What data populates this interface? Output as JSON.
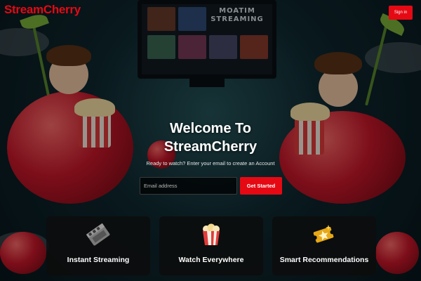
{
  "header": {
    "logo_text": "StreamCherry",
    "signin_label": "Sign in"
  },
  "hero": {
    "title_line1": "Welcome To",
    "title_line2": "StreamCherry",
    "subtitle": "Ready to watch? Enter your email to create an Account",
    "email_placeholder": "Email address",
    "cta_label": "Get Started"
  },
  "features": [
    {
      "label": "Instant Streaming",
      "icon": "film-clapper-icon"
    },
    {
      "label": "Watch Everywhere",
      "icon": "popcorn-icon"
    },
    {
      "label": "Smart Recommendations",
      "icon": "ticket-star-icon"
    }
  ],
  "background": {
    "screen_text": "MOATIM STREAMING"
  },
  "colors": {
    "brand": "#e50914",
    "card_bg": "#0c0c0c"
  }
}
